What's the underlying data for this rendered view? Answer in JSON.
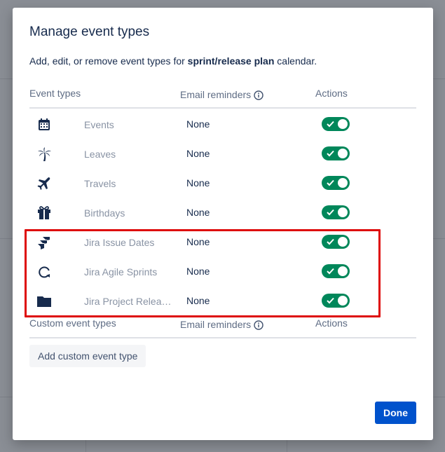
{
  "modal": {
    "title": "Manage event types",
    "description_prefix": "Add, edit, or remove event types for ",
    "description_bold": "sprint/release plan",
    "description_suffix": " calendar."
  },
  "table": {
    "col_event_types": "Event types",
    "col_email_reminders": "Email reminders",
    "col_actions": "Actions",
    "rows": [
      {
        "icon": "calendar-icon",
        "name": "Events",
        "reminder": "None",
        "enabled": true
      },
      {
        "icon": "palm-tree-icon",
        "name": "Leaves",
        "reminder": "None",
        "enabled": true
      },
      {
        "icon": "airplane-icon",
        "name": "Travels",
        "reminder": "None",
        "enabled": true
      },
      {
        "icon": "gift-icon",
        "name": "Birthdays",
        "reminder": "None",
        "enabled": true
      },
      {
        "icon": "jira-icon",
        "name": "Jira Issue Dates",
        "reminder": "None",
        "enabled": true
      },
      {
        "icon": "sprint-cycle-icon",
        "name": "Jira Agile Sprints",
        "reminder": "None",
        "enabled": true
      },
      {
        "icon": "folder-icon",
        "name": "Jira Project Releases",
        "reminder": "None",
        "enabled": true
      }
    ]
  },
  "custom": {
    "col_custom_event_types": "Custom event types",
    "col_email_reminders": "Email reminders",
    "col_actions": "Actions",
    "add_button_label": "Add custom event type"
  },
  "footer": {
    "done_label": "Done"
  },
  "colors": {
    "toggle_on": "#00875a",
    "primary": "#0052cc",
    "highlight": "#de0a0a"
  }
}
